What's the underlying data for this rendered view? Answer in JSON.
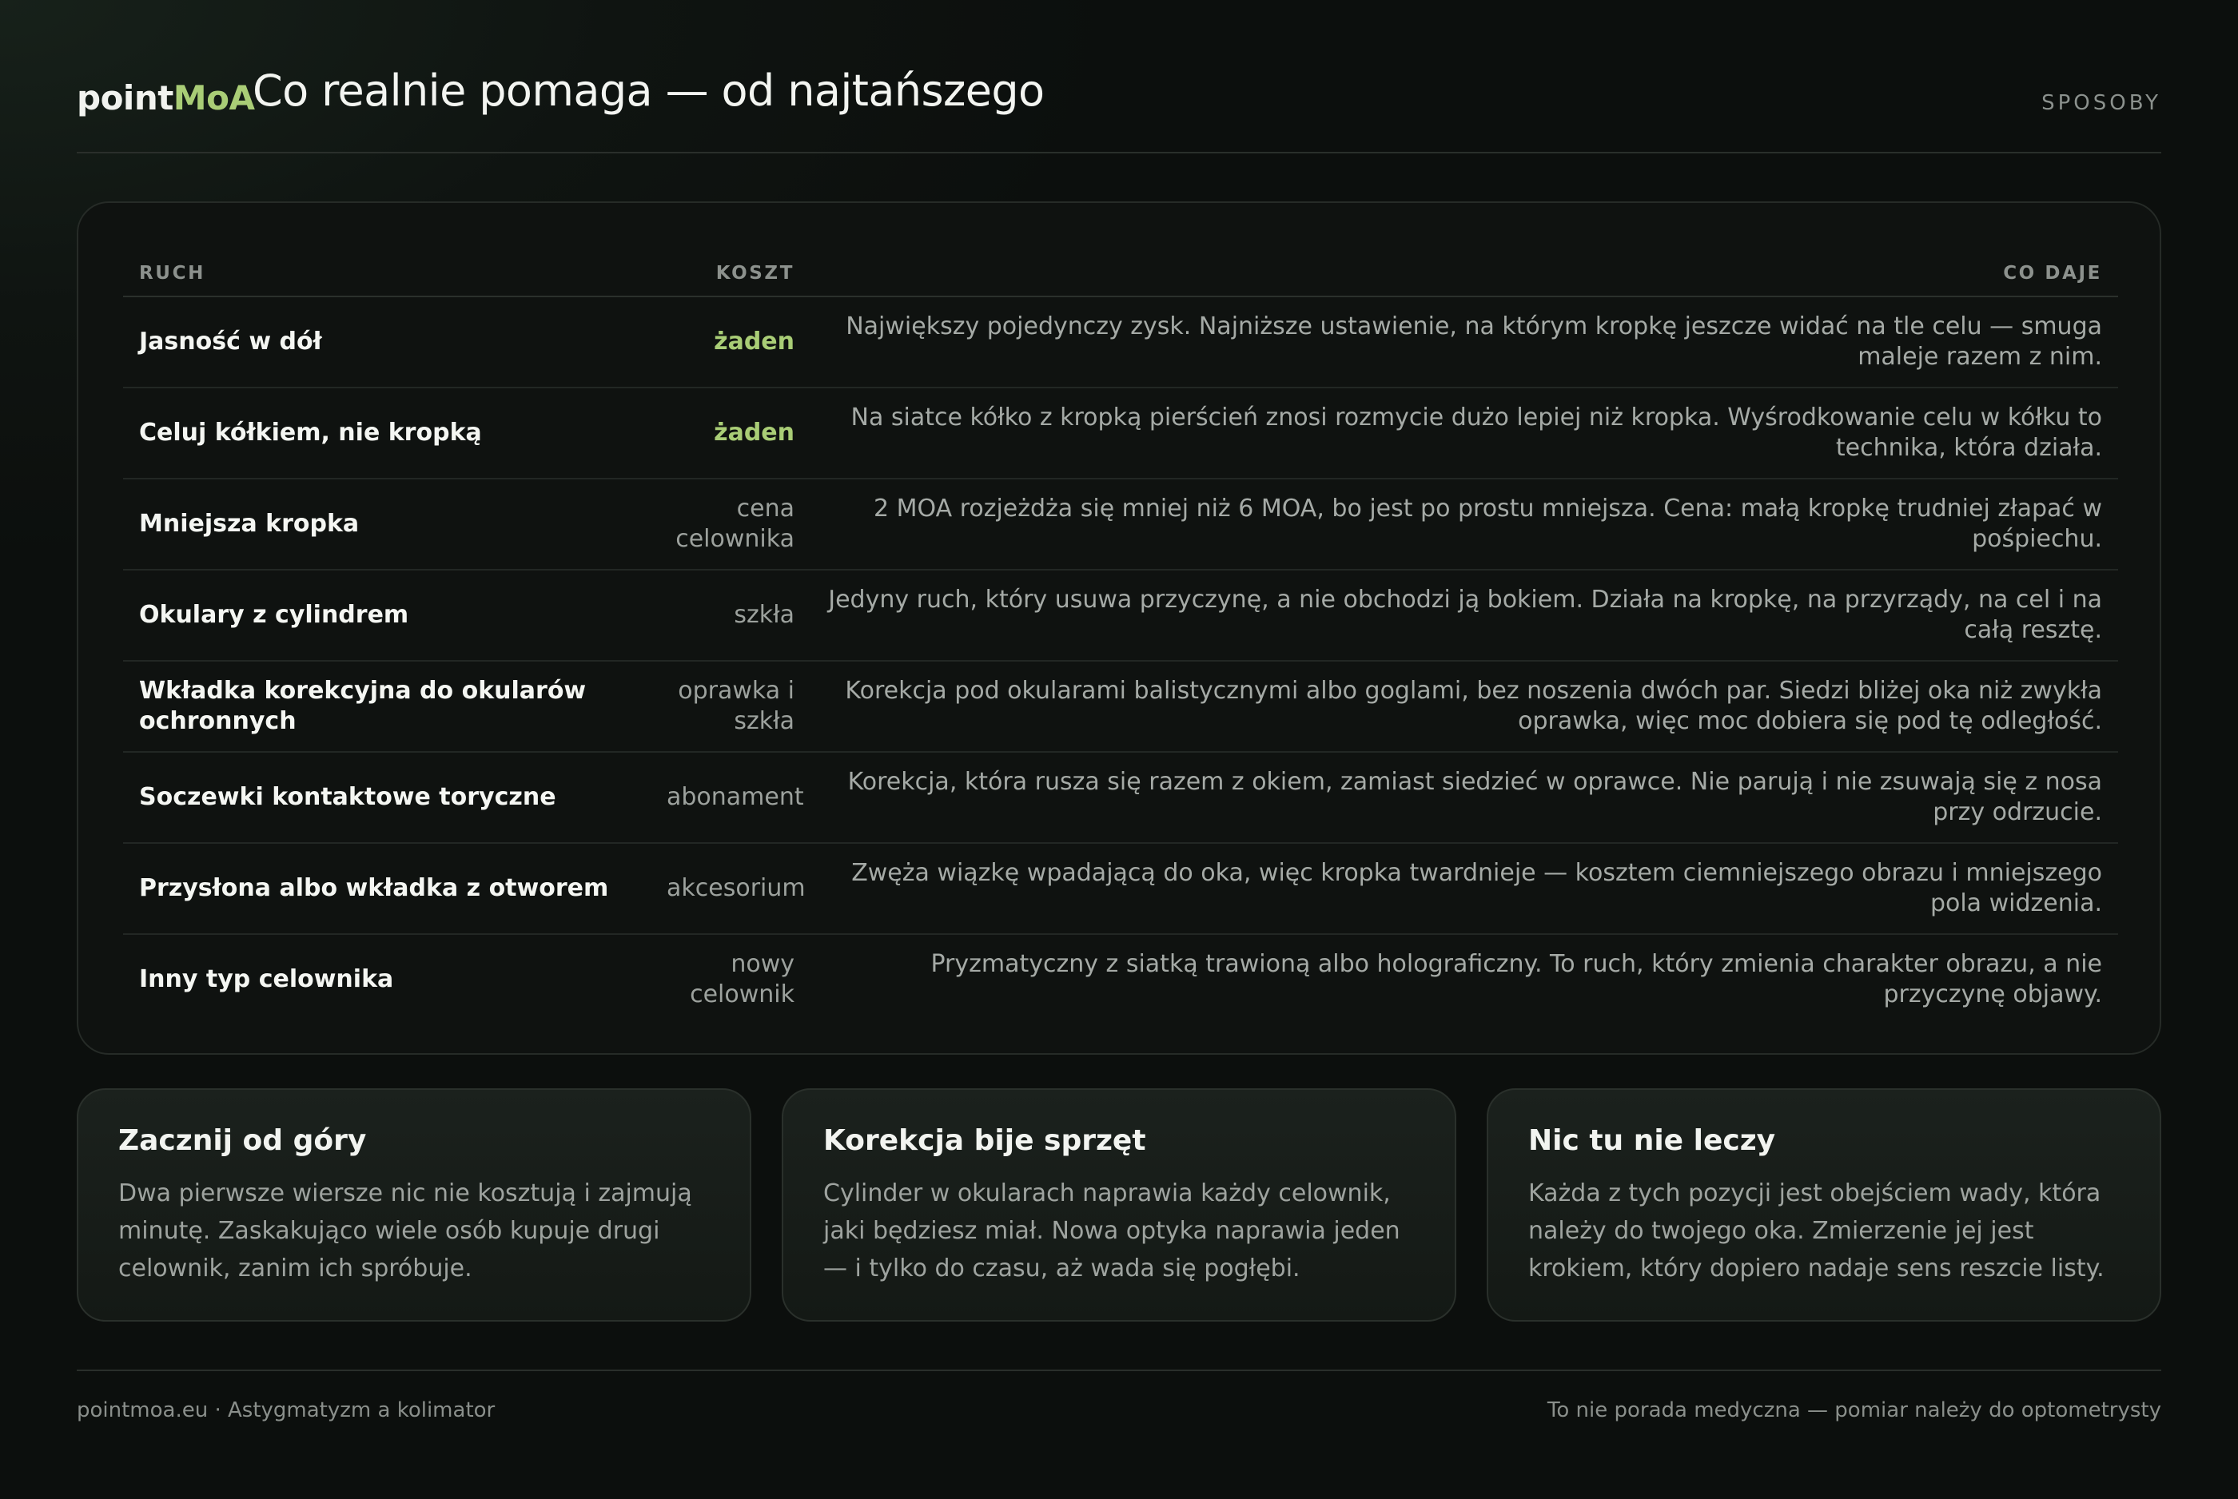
{
  "header": {
    "logo_main": "point",
    "logo_accent": "MoA",
    "title": "Co realnie pomaga — od najtańszego",
    "section_tag": "SPOSOBY"
  },
  "table": {
    "columns": [
      "RUCH",
      "KOSZT",
      "CO DAJE"
    ],
    "rows": [
      {
        "move": "Jasność w dół",
        "cost": "żaden",
        "gives": "Największy pojedynczy zysk. Najniższe ustawienie, na którym kropkę jeszcze widać na tle celu — smuga maleje razem z nim."
      },
      {
        "move": "Celuj kółkiem, nie kropką",
        "cost": "żaden",
        "gives": "Na siatce kółko z kropką pierścień znosi rozmycie dużo lepiej niż kropka. Wyśrodkowanie celu w kółku to technika, która działa."
      },
      {
        "move": "Mniejsza kropka",
        "cost": "cena celownika",
        "gives": "2 MOA rozjeżdża się mniej niż 6 MOA, bo jest po prostu mniejsza. Cena: małą kropkę trudniej złapać w pośpiechu."
      },
      {
        "move": "Okulary z cylindrem",
        "cost": "szkła",
        "gives": "Jedyny ruch, który usuwa przyczynę, a nie obchodzi ją bokiem. Działa na kropkę, na przyrządy, na cel i na całą resztę."
      },
      {
        "move": "Wkładka korekcyjna do okularów ochronnych",
        "cost": "oprawka i szkła",
        "gives": "Korekcja pod okularami balistycznymi albo goglami, bez noszenia dwóch par. Siedzi bliżej oka niż zwykła oprawka, więc moc dobiera się pod tę odległość."
      },
      {
        "move": "Soczewki kontaktowe toryczne",
        "cost": "abonament",
        "gives": "Korekcja, która rusza się razem z okiem, zamiast siedzieć w oprawce. Nie parują i nie zsuwają się z nosa przy odrzucie."
      },
      {
        "move": "Przysłona albo wkładka z otworem",
        "cost": "akcesorium",
        "gives": "Zwęża wiązkę wpadającą do oka, więc kropka twardnieje — kosztem ciemniejszego obrazu i mniejszego pola widzenia."
      },
      {
        "move": "Inny typ celownika",
        "cost": "nowy celownik",
        "gives": "Pryzmatyczny z siatką trawioną albo holograficzny. To ruch, który zmienia charakter obrazu, a nie przyczynę objawy."
      }
    ]
  },
  "cards": [
    {
      "title": "Zacznij od góry",
      "text": "Dwa pierwsze wiersze nic nie kosztują i zajmują minutę. Zaskakująco wiele osób kupuje drugi celownik, zanim ich spróbuje."
    },
    {
      "title": "Korekcja bije sprzęt",
      "text": "Cylinder w okularach naprawia każdy celownik, jaki będziesz miał. Nowa optyka naprawia jeden — i tylko do czasu, aż wada się pogłębi."
    },
    {
      "title": "Nic tu nie leczy",
      "text": "Każda z tych pozycji jest obejściem wady, która należy do twojego oka. Zmierzenie jej jest krokiem, który dopiero nadaje sens reszcie listy."
    }
  ],
  "footer": {
    "left": "pointmoa.eu · Astygmatyzm a kolimator",
    "right": "To nie porada medyczna — pomiar należy do optometrysty"
  },
  "colors": {
    "accent": "#a9cd76",
    "background": "#0d100e",
    "text": "#e9ece8"
  }
}
